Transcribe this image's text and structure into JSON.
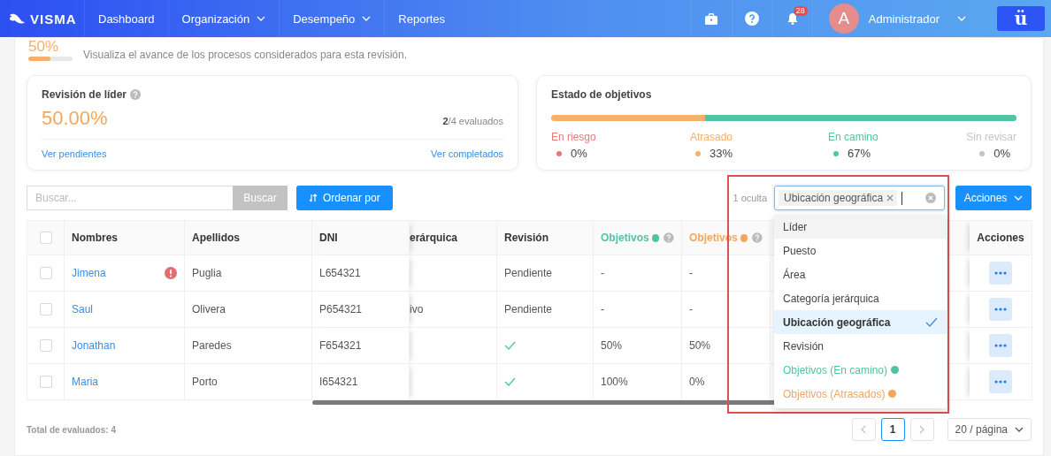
{
  "navbar": {
    "logo": "VISMA",
    "items": [
      {
        "label": "Dashboard",
        "dropdown": false
      },
      {
        "label": "Organización",
        "dropdown": true
      },
      {
        "label": "Desempeño",
        "dropdown": true
      },
      {
        "label": "Reportes",
        "dropdown": false
      }
    ],
    "notifications": "28",
    "user": {
      "initial": "A",
      "name": "Administrador"
    },
    "app_button": "ü"
  },
  "progress": {
    "percent": "50%",
    "level": 0.5,
    "description": "Visualiza el avance de los procesos considerados para esta revisión."
  },
  "leader_review": {
    "title": "Revisión de líder",
    "percent": "50.00%",
    "done": "2",
    "total": "/4 evaluados",
    "links": [
      "Ver pendientes",
      "Ver completados"
    ]
  },
  "objectives": {
    "title": "Estado de objetivos",
    "segments": [
      {
        "label": "En riesgo",
        "value": "0%",
        "color": "#e07b7b"
      },
      {
        "label": "Atrasado",
        "value": "33%",
        "level": 0.33,
        "color": "#f5b06b"
      },
      {
        "label": "En camino",
        "value": "67%",
        "level": 0.67,
        "color": "#4fc4a4"
      },
      {
        "label": "Sin revisar",
        "value": "0%",
        "color": "#c4c4c4"
      }
    ]
  },
  "toolbar": {
    "search_placeholder": "Buscar...",
    "search_button": "Buscar",
    "sort_button": "Ordenar por",
    "hidden_count": "1 oculta",
    "column_tags": [
      "Ubicación geográfica"
    ],
    "actions_button": "Acciones"
  },
  "column_menu": [
    {
      "label": "Líder",
      "selected": false,
      "highlighted": true
    },
    {
      "label": "Puesto",
      "selected": false,
      "highlighted": false
    },
    {
      "label": "Área",
      "selected": false,
      "highlighted": false
    },
    {
      "label": "Categoría jerárquica",
      "selected": false,
      "highlighted": false
    },
    {
      "label": "Ubicación geográfica",
      "selected": true,
      "highlighted": false
    },
    {
      "label": "Revisión",
      "selected": false,
      "highlighted": false
    },
    {
      "label": "Objetivos (En camino)",
      "selected": false,
      "highlighted": false,
      "color": "#4fc4a4"
    },
    {
      "label": "Objetivos (Atrasados)",
      "selected": false,
      "highlighted": false,
      "color": "#f5a65b"
    }
  ],
  "table": {
    "all_checked": false,
    "columns": [
      {
        "label": "Nombres"
      },
      {
        "label": "Apellidos"
      },
      {
        "label": "DNI"
      },
      {
        "label": "erárquica"
      },
      {
        "label": "Revisión"
      },
      {
        "label": "Objetivos",
        "color": "#4fc4a4"
      },
      {
        "label": "Objetivos",
        "color": "#f5a65b"
      },
      {
        "label": "Acciones"
      }
    ],
    "rows": [
      {
        "checked": false,
        "name": "Jimena",
        "alert": true,
        "surname": "Puglia",
        "dni": "L654321",
        "reviewed": false,
        "revision": "Pendiente",
        "on_track": "-",
        "late": "-"
      },
      {
        "checked": false,
        "name": "Saul",
        "alert": false,
        "surname": "Olivera",
        "dni": "P654321",
        "column_4": "ivo",
        "reviewed": false,
        "revision": "Pendiente",
        "on_track": "-",
        "late": "-"
      },
      {
        "checked": false,
        "name": "Jonathan",
        "alert": false,
        "surname": "Paredes",
        "dni": "F654321",
        "reviewed": true,
        "on_track": "50%",
        "late": "50%"
      },
      {
        "checked": false,
        "name": "Maria",
        "alert": false,
        "surname": "Porto",
        "dni": "I654321",
        "reviewed": true,
        "on_track": "100%",
        "late": "0%"
      }
    ]
  },
  "footer": {
    "total": "Total de evaluados: 4",
    "pages": [
      {
        "label": "1",
        "selected": true
      }
    ],
    "page_size": "20 / página"
  }
}
